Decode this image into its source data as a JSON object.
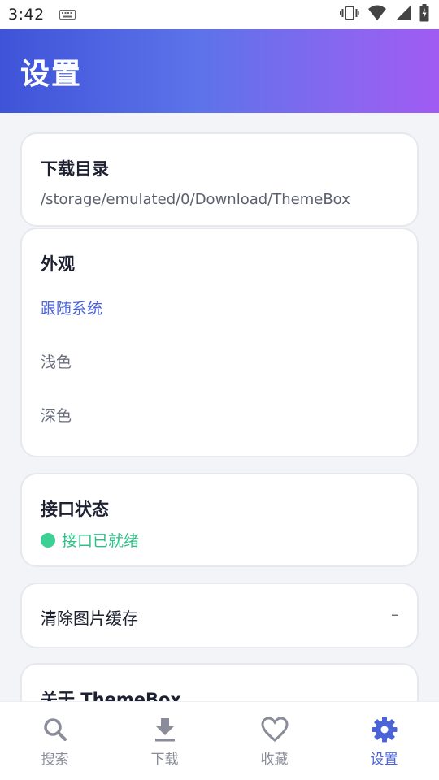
{
  "status_bar": {
    "time": "3:42"
  },
  "header": {
    "title": "设置"
  },
  "cards": {
    "download": {
      "title": "下载目录",
      "path": "/storage/emulated/0/Download/ThemeBox"
    },
    "appearance": {
      "title": "外观",
      "options": [
        {
          "label": "跟随系统",
          "selected": true
        },
        {
          "label": "浅色",
          "selected": false
        },
        {
          "label": "深色",
          "selected": false
        }
      ]
    },
    "api": {
      "title": "接口状态",
      "status": "接口已就绪",
      "status_color": "#3ecf95"
    },
    "cache": {
      "label": "清除图片缓存",
      "value": "–"
    },
    "about": {
      "title": "关于 ThemeBox"
    }
  },
  "bottom_nav": {
    "items": [
      {
        "label": "搜索",
        "icon": "search-icon",
        "active": false
      },
      {
        "label": "下载",
        "icon": "download-icon",
        "active": false
      },
      {
        "label": "收藏",
        "icon": "heart-icon",
        "active": false
      },
      {
        "label": "设置",
        "icon": "gear-icon",
        "active": true
      }
    ]
  },
  "colors": {
    "accent": "#4a63d8",
    "success": "#3ecf95",
    "header_gradient_start": "#3f53d8",
    "header_gradient_end": "#a05bf3"
  }
}
